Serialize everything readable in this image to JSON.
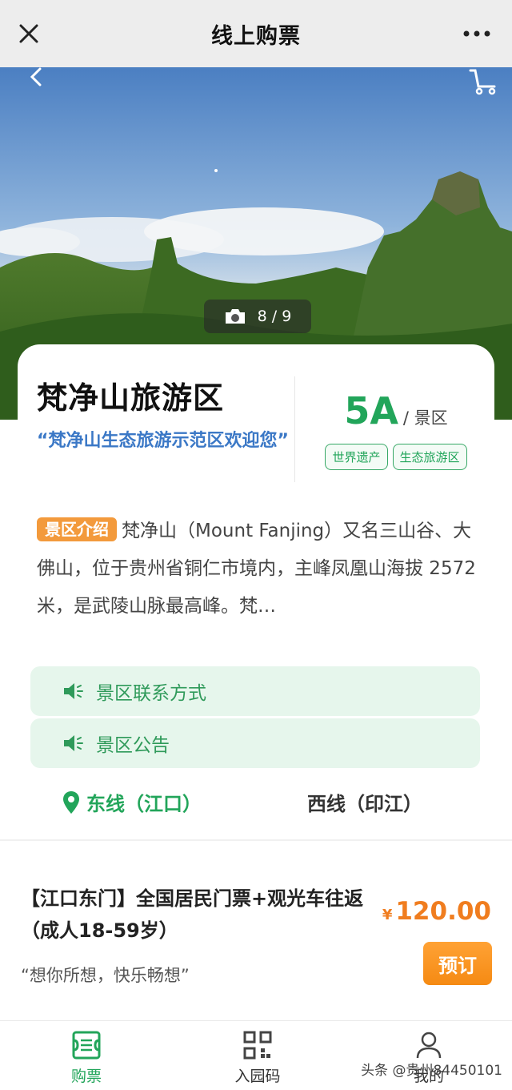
{
  "topbar": {
    "title": "线上购票",
    "close_icon": "close-icon",
    "more_icon": "more-dots-icon"
  },
  "hero": {
    "photo_counter": "8 / 9",
    "back_icon": "chevron-left-icon",
    "cart_icon": "cart-icon",
    "camera_icon": "camera-icon"
  },
  "card": {
    "park_name": "梵净山旅游区",
    "slogan": "“梵净山生态旅游示范区欢迎您”",
    "grade": "5A",
    "grade_unit": "/ 景区",
    "tags": [
      "世界遗产",
      "生态旅游区"
    ]
  },
  "intro": {
    "badge": "景区介绍",
    "text": "梵净山（Mount Fanjing）又名三山谷、大佛山，位于贵州省铜仁市境内，主峰凤凰山海拔 2572 米，是武陵山脉最高峰。梵…"
  },
  "notices": [
    {
      "label": "景区联系方式",
      "icon": "speaker-icon"
    },
    {
      "label": "景区公告",
      "icon": "speaker-icon"
    }
  ],
  "routes": {
    "east": "东线（江口）",
    "west": "西线（印江）"
  },
  "ticket": {
    "name": "【江口东门】全国居民门票+观光车往返（成人18-59岁）",
    "subtitle": "“想你所想，快乐畅想”",
    "currency": "¥",
    "price": "120.00",
    "book_label": "预订"
  },
  "bottom_nav": {
    "items": [
      {
        "label": "购票",
        "icon": "ticket-icon"
      },
      {
        "label": "入园码",
        "icon": "qr-code-icon"
      },
      {
        "label": "我的",
        "icon": "user-icon"
      }
    ]
  },
  "watermark": "头条 @贵州84450101",
  "colors": {
    "accent_green": "#22a55a",
    "slogan_blue": "#3b78c6",
    "orange": "#f58a13",
    "notice_bg": "#e6f6ec"
  }
}
